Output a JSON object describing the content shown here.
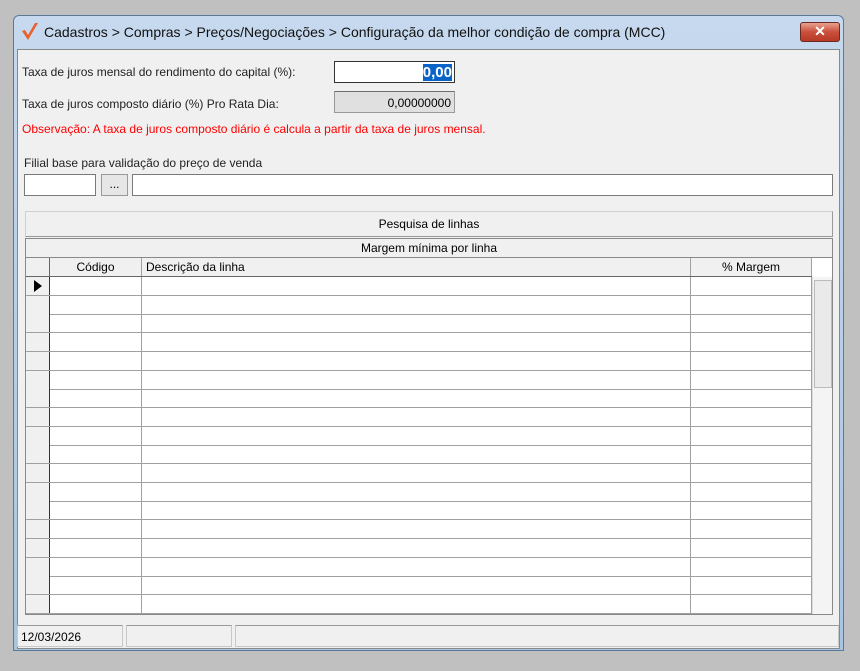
{
  "window": {
    "title": "Cadastros > Compras > Preços/Negociações > Configuração da melhor condição de compra (MCC)",
    "close_label": "✕",
    "logo_color": "#e8602c"
  },
  "form": {
    "taxa_mensal_label": "Taxa de juros mensal do rendimento do capital (%):",
    "taxa_mensal_value": "0,00",
    "taxa_diaria_label": "Taxa de juros composto diário (%) Pro Rata Dia:",
    "taxa_diaria_value": "0,00000000",
    "observacao": "Observação: A taxa de juros composto diário é calcula a partir da taxa de juros mensal.",
    "filial_label": "Filial base para validação do preço de venda",
    "filial_code": "",
    "filial_button": "...",
    "filial_name": ""
  },
  "grid": {
    "search_button": "Pesquisa de linhas",
    "band_title": "Margem mínima por linha",
    "columns": [
      "Código",
      "Descrição da linha",
      "% Margem"
    ],
    "row_count": 18
  },
  "status": {
    "date": "12/03/2026",
    "panel2": "",
    "panel3": ""
  },
  "colors": {
    "observation": "#ff0000",
    "selection": "#0a64c8"
  }
}
